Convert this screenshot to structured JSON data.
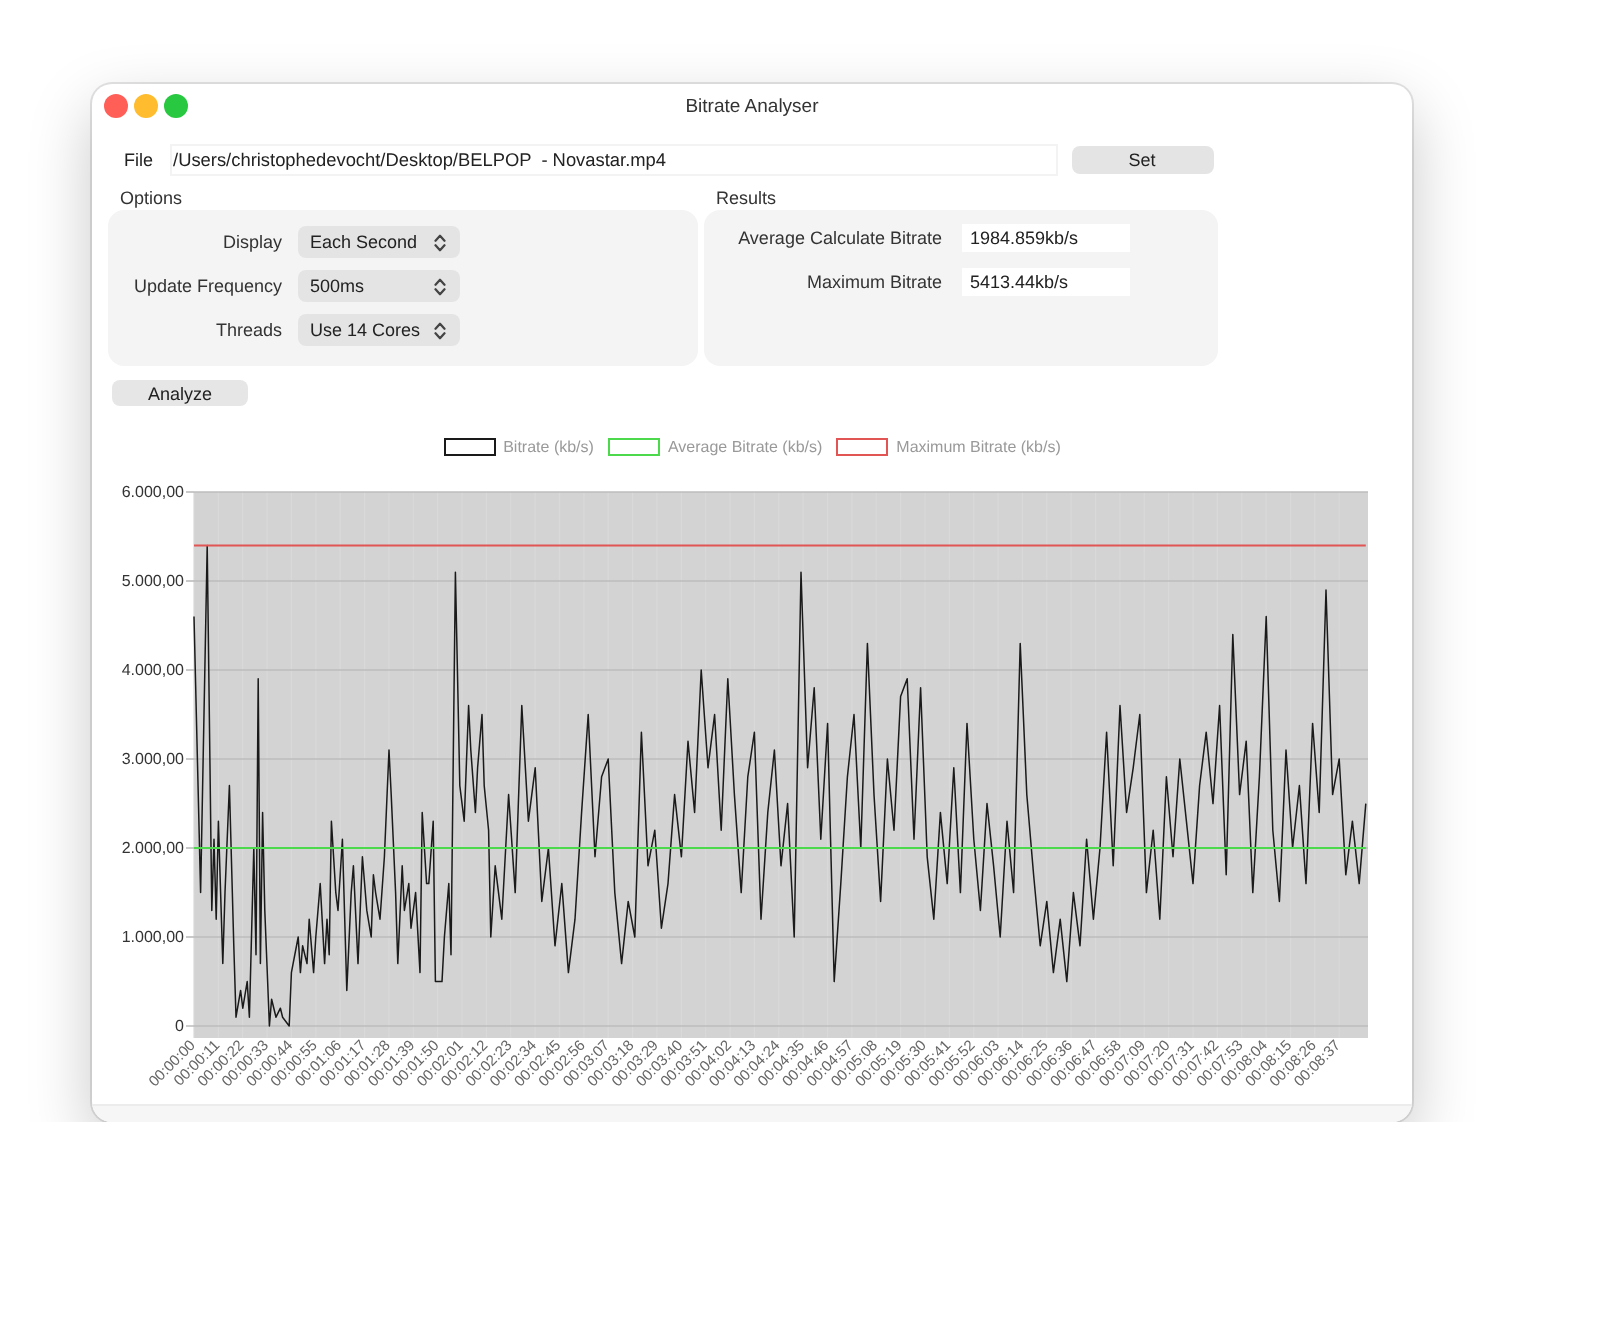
{
  "window": {
    "title": "Bitrate Analyser"
  },
  "file": {
    "label": "File",
    "value": "/Users/christophedevocht/Desktop/BELPOP  - Novastar.mp4",
    "button": "Set"
  },
  "options": {
    "title": "Options",
    "rows": [
      {
        "label": "Display",
        "value": "Each Second"
      },
      {
        "label": "Update Frequency",
        "value": "500ms"
      },
      {
        "label": "Threads",
        "value": "Use 14 Cores"
      }
    ]
  },
  "results": {
    "title": "Results",
    "rows": [
      {
        "label": "Average Calculate Bitrate",
        "value": "1984.859kb/s"
      },
      {
        "label": "Maximum Bitrate",
        "value": "5413.44kb/s"
      }
    ]
  },
  "analyze_button": "Analyze",
  "chart": {
    "chart_data": {
      "type": "line",
      "grid": true,
      "legend": true,
      "xlim": [
        0,
        530
      ],
      "ylim": [
        0,
        6000
      ],
      "yticks": [
        {
          "value": 0,
          "label": "0"
        },
        {
          "value": 1000,
          "label": "1.000,00"
        },
        {
          "value": 2000,
          "label": "2.000,00"
        },
        {
          "value": 3000,
          "label": "3.000,00"
        },
        {
          "value": 4000,
          "label": "4.000,00"
        },
        {
          "value": 5000,
          "label": "5.000,00"
        },
        {
          "value": 6000,
          "label": "6.000,00"
        }
      ],
      "xticks": [
        {
          "value": 0,
          "label": "00:00:00"
        },
        {
          "value": 11,
          "label": "00:00:11"
        },
        {
          "value": 22,
          "label": "00:00:22"
        },
        {
          "value": 33,
          "label": "00:00:33"
        },
        {
          "value": 44,
          "label": "00:00:44"
        },
        {
          "value": 55,
          "label": "00:00:55"
        },
        {
          "value": 66,
          "label": "00:01:06"
        },
        {
          "value": 77,
          "label": "00:01:17"
        },
        {
          "value": 88,
          "label": "00:01:28"
        },
        {
          "value": 99,
          "label": "00:01:39"
        },
        {
          "value": 110,
          "label": "00:01:50"
        },
        {
          "value": 121,
          "label": "00:02:01"
        },
        {
          "value": 132,
          "label": "00:02:12"
        },
        {
          "value": 143,
          "label": "00:02:23"
        },
        {
          "value": 154,
          "label": "00:02:34"
        },
        {
          "value": 165,
          "label": "00:02:45"
        },
        {
          "value": 176,
          "label": "00:02:56"
        },
        {
          "value": 187,
          "label": "00:03:07"
        },
        {
          "value": 198,
          "label": "00:03:18"
        },
        {
          "value": 209,
          "label": "00:03:29"
        },
        {
          "value": 220,
          "label": "00:03:40"
        },
        {
          "value": 231,
          "label": "00:03:51"
        },
        {
          "value": 242,
          "label": "00:04:02"
        },
        {
          "value": 253,
          "label": "00:04:13"
        },
        {
          "value": 264,
          "label": "00:04:24"
        },
        {
          "value": 275,
          "label": "00:04:35"
        },
        {
          "value": 286,
          "label": "00:04:46"
        },
        {
          "value": 297,
          "label": "00:04:57"
        },
        {
          "value": 308,
          "label": "00:05:08"
        },
        {
          "value": 319,
          "label": "00:05:19"
        },
        {
          "value": 330,
          "label": "00:05:30"
        },
        {
          "value": 341,
          "label": "00:05:41"
        },
        {
          "value": 352,
          "label": "00:05:52"
        },
        {
          "value": 363,
          "label": "00:06:03"
        },
        {
          "value": 374,
          "label": "00:06:14"
        },
        {
          "value": 385,
          "label": "00:06:25"
        },
        {
          "value": 396,
          "label": "00:06:36"
        },
        {
          "value": 407,
          "label": "00:06:47"
        },
        {
          "value": 418,
          "label": "00:06:58"
        },
        {
          "value": 429,
          "label": "00:07:09"
        },
        {
          "value": 440,
          "label": "00:07:20"
        },
        {
          "value": 451,
          "label": "00:07:31"
        },
        {
          "value": 462,
          "label": "00:07:42"
        },
        {
          "value": 473,
          "label": "00:07:53"
        },
        {
          "value": 484,
          "label": "00:08:04"
        },
        {
          "value": 495,
          "label": "00:08:15"
        },
        {
          "value": 506,
          "label": "00:08:26"
        },
        {
          "value": 517,
          "label": "00:08:37"
        }
      ],
      "x": [
        0,
        3,
        6,
        8,
        9,
        10,
        11,
        13,
        14,
        16,
        18,
        19,
        21,
        22,
        24,
        25,
        27,
        28,
        29,
        30,
        31,
        32,
        34,
        35,
        37,
        39,
        40,
        43,
        44,
        47,
        48,
        49,
        51,
        52,
        54,
        55,
        57,
        59,
        60,
        61,
        62,
        64,
        65,
        67,
        69,
        71,
        72,
        74,
        76,
        78,
        80,
        81,
        82,
        84,
        86,
        88,
        89,
        91,
        92,
        94,
        95,
        97,
        98,
        100,
        102,
        103,
        105,
        106,
        108,
        109,
        112,
        113,
        115,
        116,
        118,
        120,
        122,
        124,
        125,
        127,
        128,
        130,
        131,
        133,
        134,
        136,
        139,
        142,
        145,
        148,
        151,
        154,
        157,
        160,
        163,
        166,
        169,
        172,
        175,
        178,
        181,
        184,
        187,
        190,
        193,
        196,
        199,
        202,
        205,
        208,
        211,
        214,
        217,
        220,
        223,
        226,
        229,
        232,
        235,
        238,
        241,
        244,
        247,
        250,
        253,
        256,
        259,
        262,
        265,
        268,
        271,
        274,
        277,
        280,
        283,
        286,
        289,
        292,
        295,
        298,
        301,
        304,
        307,
        310,
        313,
        316,
        319,
        322,
        325,
        328,
        331,
        334,
        337,
        340,
        343,
        346,
        349,
        352,
        355,
        358,
        361,
        364,
        367,
        370,
        373,
        376,
        379,
        382,
        385,
        388,
        391,
        394,
        397,
        400,
        403,
        406,
        409,
        412,
        415,
        418,
        421,
        424,
        427,
        430,
        433,
        436,
        439,
        442,
        445,
        448,
        451,
        454,
        457,
        460,
        463,
        466,
        469,
        472,
        475,
        478,
        481,
        484,
        487,
        490,
        493,
        496,
        499,
        502,
        505,
        508,
        511,
        514,
        517,
        520,
        523,
        526,
        529
      ],
      "series": [
        {
          "name": "Bitrate (kb/s)",
          "color": "#1a1a1a",
          "values": [
            4600,
            1500,
            5400,
            1300,
            2100,
            1200,
            2300,
            700,
            1500,
            2700,
            900,
            100,
            400,
            200,
            500,
            100,
            2000,
            800,
            3900,
            700,
            2400,
            1300,
            0,
            300,
            100,
            200,
            100,
            0,
            600,
            1000,
            600,
            900,
            700,
            1200,
            600,
            1000,
            1600,
            700,
            1200,
            800,
            2300,
            1500,
            1300,
            2100,
            400,
            1500,
            1800,
            700,
            1900,
            1300,
            1000,
            1700,
            1500,
            1200,
            1900,
            3100,
            2600,
            1500,
            700,
            1800,
            1300,
            1600,
            1100,
            1500,
            600,
            2400,
            1600,
            1600,
            2300,
            500,
            500,
            1000,
            1600,
            800,
            5100,
            2700,
            2300,
            3600,
            3100,
            2400,
            2900,
            3500,
            2700,
            2200,
            1000,
            1800,
            1200,
            2600,
            1500,
            3600,
            2300,
            2900,
            1400,
            2000,
            900,
            1600,
            600,
            1200,
            2400,
            3500,
            1900,
            2800,
            3000,
            1500,
            700,
            1400,
            1000,
            3300,
            1800,
            2200,
            1100,
            1600,
            2600,
            1900,
            3200,
            2400,
            4000,
            2900,
            3500,
            2200,
            3900,
            2600,
            1500,
            2800,
            3300,
            1200,
            2400,
            3100,
            1800,
            2500,
            1000,
            5100,
            2900,
            3800,
            2100,
            3400,
            500,
            1600,
            2800,
            3500,
            2000,
            4300,
            2600,
            1400,
            3000,
            2200,
            3700,
            3900,
            2100,
            3800,
            1900,
            1200,
            2400,
            1600,
            2900,
            1500,
            3400,
            2100,
            1300,
            2500,
            1800,
            1000,
            2300,
            1500,
            4300,
            2600,
            1700,
            900,
            1400,
            600,
            1200,
            500,
            1500,
            900,
            2100,
            1200,
            2000,
            3300,
            1800,
            3600,
            2400,
            2900,
            3500,
            1500,
            2200,
            1200,
            2800,
            1900,
            3000,
            2300,
            1600,
            2700,
            3300,
            2500,
            3600,
            1700,
            4400,
            2600,
            3200,
            1500,
            2800,
            4600,
            2200,
            1400,
            3100,
            2000,
            2700,
            1600,
            3400,
            2400,
            4900,
            2600,
            3000,
            1700,
            2300,
            1600,
            2500
          ]
        },
        {
          "name": "Average Bitrate (kb/s)",
          "color": "#4cd94c",
          "values": [
            2000,
            2000,
            2000,
            2000,
            2000,
            2000,
            2000,
            2000,
            2000,
            2000,
            2000,
            2000,
            2000,
            2000,
            2000,
            2000,
            2000,
            2000,
            2000,
            2000,
            2000,
            2000,
            2000,
            2000,
            2000,
            2000,
            2000,
            2000,
            2000,
            2000,
            2000,
            2000,
            2000,
            2000,
            2000,
            2000,
            2000,
            2000,
            2000,
            2000,
            2000,
            2000,
            2000,
            2000,
            2000,
            2000,
            2000,
            2000,
            2000,
            2000,
            2000,
            2000,
            2000,
            2000,
            2000,
            2000,
            2000,
            2000,
            2000,
            2000,
            2000,
            2000,
            2000,
            2000,
            2000,
            2000,
            2000,
            2000,
            2000,
            2000,
            2000,
            2000,
            2000,
            2000,
            2000,
            2000,
            2000,
            2000,
            2000,
            2000,
            2000,
            2000,
            2000,
            2000,
            2000,
            2000,
            2000,
            2000,
            2000,
            2000,
            2000,
            2000,
            2000,
            2000,
            2000,
            2000,
            2000,
            2000,
            2000,
            2000,
            2000,
            2000,
            2000,
            2000,
            2000,
            2000,
            2000,
            2000,
            2000,
            2000,
            2000,
            2000,
            2000,
            2000,
            2000,
            2000,
            2000,
            2000,
            2000,
            2000,
            2000,
            2000,
            2000,
            2000,
            2000,
            2000,
            2000,
            2000,
            2000,
            2000,
            2000,
            2000,
            2000,
            2000,
            2000,
            2000,
            2000,
            2000,
            2000,
            2000,
            2000,
            2000,
            2000,
            2000,
            2000,
            2000,
            2000,
            2000,
            2000,
            2000,
            2000,
            2000,
            2000,
            2000,
            2000,
            2000,
            2000,
            2000,
            2000,
            2000,
            2000,
            2000,
            2000,
            2000,
            2000,
            2000,
            2000,
            2000,
            2000,
            2000,
            2000,
            2000,
            2000,
            2000,
            2000,
            2000,
            2000,
            2000,
            2000,
            2000,
            2000,
            2000,
            2000,
            2000,
            2000,
            2000,
            2000,
            2000,
            2000,
            2000,
            2000,
            2000,
            2000,
            2000,
            2000,
            2000,
            2000,
            2000,
            2000,
            2000,
            2000,
            2000,
            2000,
            2000,
            2000,
            2000,
            2000,
            2000,
            2000,
            2000,
            2000,
            2000,
            2000,
            2000,
            2000,
            2000,
            2000
          ]
        },
        {
          "name": "Maximum Bitrate (kb/s)",
          "color": "#e25555",
          "values": [
            5400,
            5400,
            5400,
            5400,
            5400,
            5400,
            5400,
            5400,
            5400,
            5400,
            5400,
            5400,
            5400,
            5400,
            5400,
            5400,
            5400,
            5400,
            5400,
            5400,
            5400,
            5400,
            5400,
            5400,
            5400,
            5400,
            5400,
            5400,
            5400,
            5400,
            5400,
            5400,
            5400,
            5400,
            5400,
            5400,
            5400,
            5400,
            5400,
            5400,
            5400,
            5400,
            5400,
            5400,
            5400,
            5400,
            5400,
            5400,
            5400,
            5400,
            5400,
            5400,
            5400,
            5400,
            5400,
            5400,
            5400,
            5400,
            5400,
            5400,
            5400,
            5400,
            5400,
            5400,
            5400,
            5400,
            5400,
            5400,
            5400,
            5400,
            5400,
            5400,
            5400,
            5400,
            5400,
            5400,
            5400,
            5400,
            5400,
            5400,
            5400,
            5400,
            5400,
            5400,
            5400,
            5400,
            5400,
            5400,
            5400,
            5400,
            5400,
            5400,
            5400,
            5400,
            5400,
            5400,
            5400,
            5400,
            5400,
            5400,
            5400,
            5400,
            5400,
            5400,
            5400,
            5400,
            5400,
            5400,
            5400,
            5400,
            5400,
            5400,
            5400,
            5400,
            5400,
            5400,
            5400,
            5400,
            5400,
            5400,
            5400,
            5400,
            5400,
            5400,
            5400,
            5400,
            5400,
            5400,
            5400,
            5400,
            5400,
            5400,
            5400,
            5400,
            5400,
            5400,
            5400,
            5400,
            5400,
            5400,
            5400,
            5400,
            5400,
            5400,
            5400,
            5400,
            5400,
            5400,
            5400,
            5400,
            5400,
            5400,
            5400,
            5400,
            5400,
            5400,
            5400,
            5400,
            5400,
            5400,
            5400,
            5400,
            5400,
            5400,
            5400,
            5400,
            5400,
            5400,
            5400,
            5400,
            5400,
            5400,
            5400,
            5400,
            5400,
            5400,
            5400,
            5400,
            5400,
            5400,
            5400,
            5400,
            5400,
            5400,
            5400,
            5400,
            5400,
            5400,
            5400,
            5400,
            5400,
            5400,
            5400,
            5400,
            5400,
            5400,
            5400,
            5400,
            5400,
            5400,
            5400,
            5400,
            5400,
            5400,
            5400,
            5400,
            5400,
            5400,
            5400,
            5400,
            5400,
            5400,
            5400,
            5400,
            5400,
            5400,
            5400
          ]
        }
      ]
    }
  }
}
